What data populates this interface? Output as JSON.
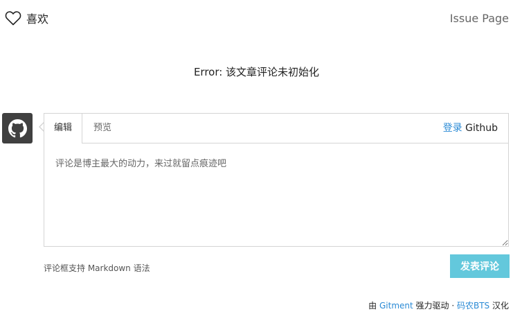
{
  "like": {
    "icon": "heart-icon",
    "label": "喜欢"
  },
  "issue_link": "Issue Page",
  "error": "Error: 该文章评论未初始化",
  "avatar": {
    "icon": "github-icon"
  },
  "editor": {
    "tab_edit": "编辑",
    "tab_preview": "预览",
    "login_link": "登录",
    "login_suffix": " Github",
    "placeholder": "评论是博主最大的动力，来过就留点痕迹吧"
  },
  "markdown_tip": "评论框支持 Markdown 语法",
  "submit_label": "发表评论",
  "footer": {
    "prefix": "由 ",
    "gitment_link": "Gitment",
    "middle": " 强力驱动 · ",
    "translator_link": "码农BTS",
    "suffix": " 汉化"
  },
  "colors": {
    "accent": "#2a8ad5",
    "submit_bg": "#63c8dc",
    "avatar_bg": "#404040"
  }
}
